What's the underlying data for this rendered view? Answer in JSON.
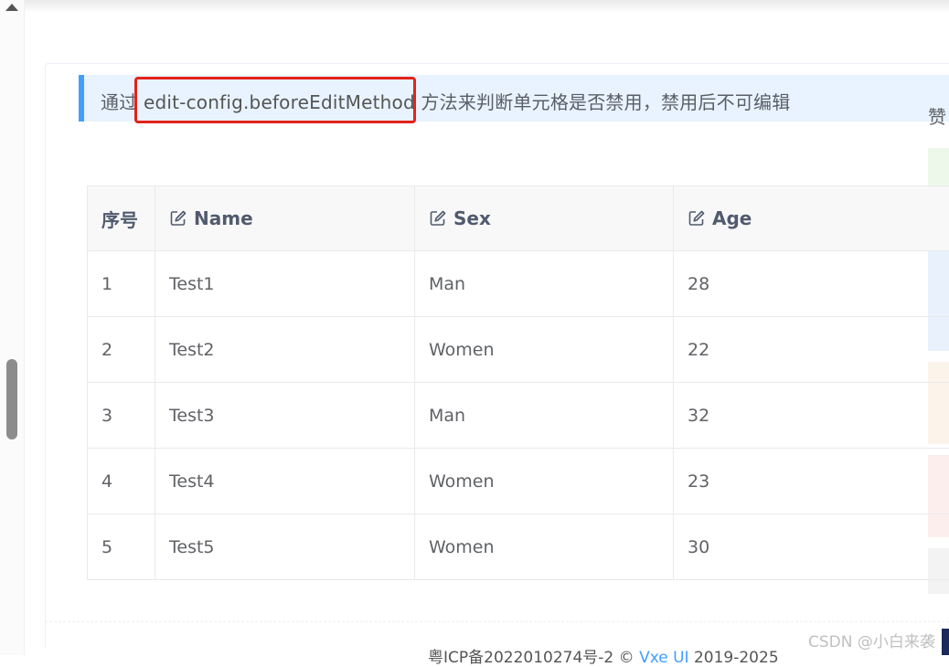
{
  "tip": {
    "prefix": "通过",
    "code": "edit-config.beforeEditMethod",
    "suffix": "方法来判断单元格是否禁用，禁用后不可编辑"
  },
  "side": {
    "label": "赞"
  },
  "table": {
    "columns": [
      {
        "label": "序号",
        "editable": false
      },
      {
        "label": "Name",
        "editable": true
      },
      {
        "label": "Sex",
        "editable": true
      },
      {
        "label": "Age",
        "editable": true
      }
    ],
    "rows": [
      {
        "seq": "1",
        "name": "Test1",
        "sex": "Man",
        "age": "28"
      },
      {
        "seq": "2",
        "name": "Test2",
        "sex": "Women",
        "age": "22"
      },
      {
        "seq": "3",
        "name": "Test3",
        "sex": "Man",
        "age": "32"
      },
      {
        "seq": "4",
        "name": "Test4",
        "sex": "Women",
        "age": "23"
      },
      {
        "seq": "5",
        "name": "Test5",
        "sex": "Women",
        "age": "30"
      }
    ]
  },
  "footer": {
    "icp": "粤ICP备2022010274号-2",
    "copyright": "©",
    "link": "Vxe UI",
    "years": "2019-2025"
  },
  "watermark": "CSDN @小白来袭",
  "colors": {
    "accent": "#409eff",
    "highlight": "#e2231a",
    "tip_bg": "#e8f3ff"
  }
}
